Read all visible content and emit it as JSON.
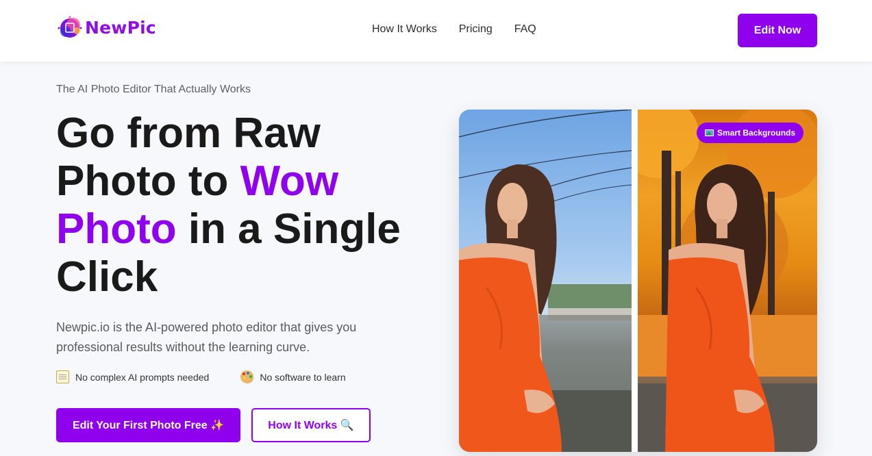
{
  "brand": {
    "name": "NewPic",
    "accent": "#8f00ec"
  },
  "nav": {
    "items": [
      "How It Works",
      "Pricing",
      "FAQ"
    ],
    "cta_label": "Edit Now"
  },
  "hero": {
    "eyebrow": "The AI Photo Editor That Actually Works",
    "headline_part1": "Go from Raw Photo to ",
    "headline_accent": "Wow Photo",
    "headline_part2": " in a Single Click",
    "subtext": "Newpic.io is the AI-powered photo editor that gives you professional results without the learning curve.",
    "features": [
      {
        "icon": "memo-icon",
        "label": "No complex AI prompts needed"
      },
      {
        "icon": "palette-icon",
        "label": "No software to learn"
      }
    ],
    "primary_cta": "Edit Your First Photo Free ✨",
    "secondary_cta": "How It Works 🔍"
  },
  "comparison": {
    "badge_icon": "framed-picture-icon",
    "badge_label": "Smart Backgrounds",
    "before_scene": "street-sky",
    "after_scene": "autumn-foliage"
  }
}
